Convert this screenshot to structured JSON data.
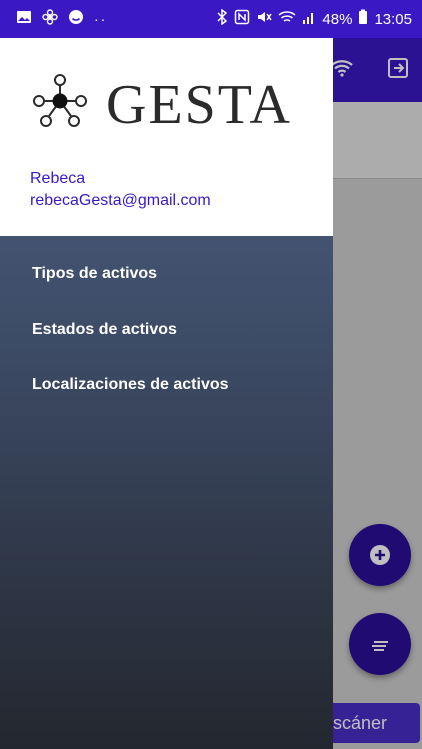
{
  "status_bar": {
    "left_icons": [
      "gallery-icon",
      "fan-icon",
      "smiley-icon",
      "dots-icon"
    ],
    "right_icons": [
      "bluetooth-icon",
      "nfc-icon",
      "mute-icon",
      "wifi-icon",
      "signal-icon",
      "battery-icon"
    ],
    "battery": "48%",
    "time": "13:05"
  },
  "app_bar": {
    "actions": [
      "wifi-icon",
      "logout-icon"
    ]
  },
  "drawer": {
    "logo_text": "GESTA",
    "user_name": "Rebeca",
    "user_email": "rebecaGesta@gmail.com",
    "items": [
      {
        "label": "Tipos de activos"
      },
      {
        "label": "Estados de activos"
      },
      {
        "label": "Localizaciones de activos"
      }
    ]
  },
  "background": {
    "scan_button_label": "scáner"
  },
  "colors": {
    "primary": "#3a18c4",
    "fab": "#2b0f9a",
    "drawer_top": "#4e6284",
    "drawer_bottom": "#23272f"
  }
}
